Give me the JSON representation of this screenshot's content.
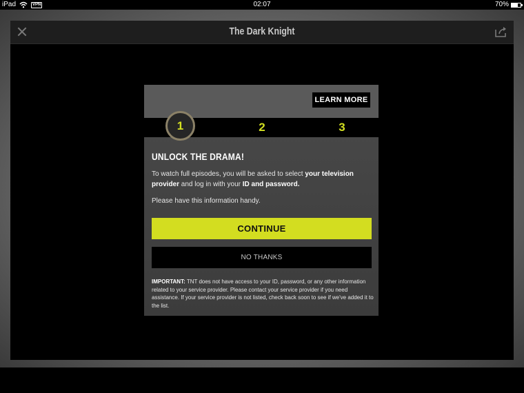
{
  "statusbar": {
    "device": "iPad",
    "vpn": "VPN",
    "time": "02:07",
    "battery": "70%",
    "battery_level": 0.7
  },
  "app": {
    "title": "The Dark Knight"
  },
  "modal": {
    "learn_more": "LEARN MORE",
    "steps": [
      "1",
      "2",
      "3"
    ],
    "title": "UNLOCK THE DRAMA!",
    "desc_1": "To watch full episodes, you will be asked to select ",
    "desc_bold_1": "your television provider",
    "desc_2": " and log in with your ",
    "desc_bold_2": "ID and password.",
    "handy": "Please have this information handy.",
    "continue_label": "CONTINUE",
    "no_thanks_label": "NO THANKS",
    "important_label": "IMPORTANT:",
    "important_text": " TNT does not have access to your ID, password, or any other information related to your service provider. Please contact your service provider if you need assistance. If your service provider is not listed, check back soon to see if we've added it to the list."
  },
  "colors": {
    "accent": "#d3dd20",
    "ring": "#8b8167"
  }
}
